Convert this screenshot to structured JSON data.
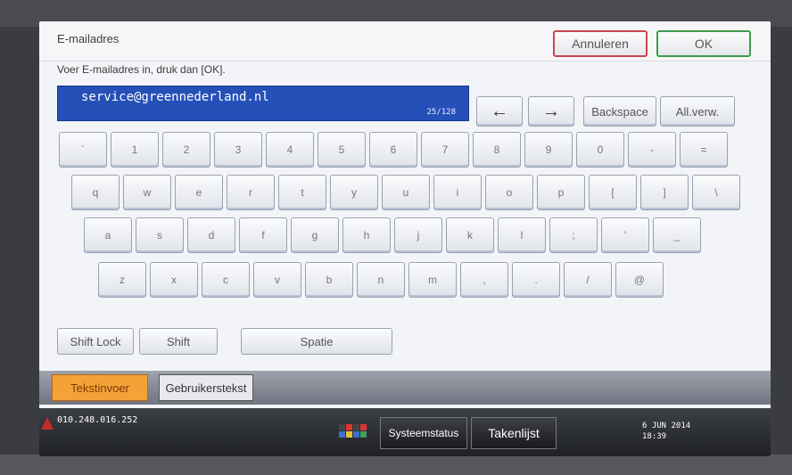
{
  "header": {
    "title": "E-mailadres",
    "cancel_label": "Annuleren",
    "ok_label": "OK"
  },
  "instruction": "Voer E-mailadres in, druk dan [OK].",
  "email": {
    "value": "service@greennederland.nl",
    "count": "25/128"
  },
  "edit_controls": {
    "left_arrow": "←",
    "right_arrow": "→",
    "backspace": "Backspace",
    "delete_all": "All.verw."
  },
  "keyboard": {
    "row1": [
      "`",
      "1",
      "2",
      "3",
      "4",
      "5",
      "6",
      "7",
      "8",
      "9",
      "0",
      "-",
      "="
    ],
    "row2": [
      "q",
      "w",
      "e",
      "r",
      "t",
      "y",
      "u",
      "i",
      "o",
      "p",
      "[",
      "]",
      "\\"
    ],
    "row3": [
      "a",
      "s",
      "d",
      "f",
      "g",
      "h",
      "j",
      "k",
      "l",
      ";",
      "'",
      "_"
    ],
    "row4": [
      "z",
      "x",
      "c",
      "v",
      "b",
      "n",
      "m",
      ",",
      ".",
      "/",
      "@"
    ]
  },
  "bottom": {
    "shift_lock": "Shift Lock",
    "shift": "Shift",
    "space": "Spatie"
  },
  "tabs": {
    "active": "Tekstinvoer",
    "inactive": "Gebruikerstekst"
  },
  "status": {
    "ip": "010.248.016.252",
    "system_status": "Systeemstatus",
    "job_list": "Takenlijst",
    "date": "6 JUN  2014",
    "time": "18:39"
  },
  "colors": {
    "accent_blue": "#2550b8",
    "cancel_red": "#c6484e",
    "ok_green": "#3e9a4b",
    "active_tab_orange": "#f4a238"
  },
  "icons": [
    "left-arrow-icon",
    "right-arrow-icon",
    "alert-icon",
    "kvch-icon"
  ]
}
